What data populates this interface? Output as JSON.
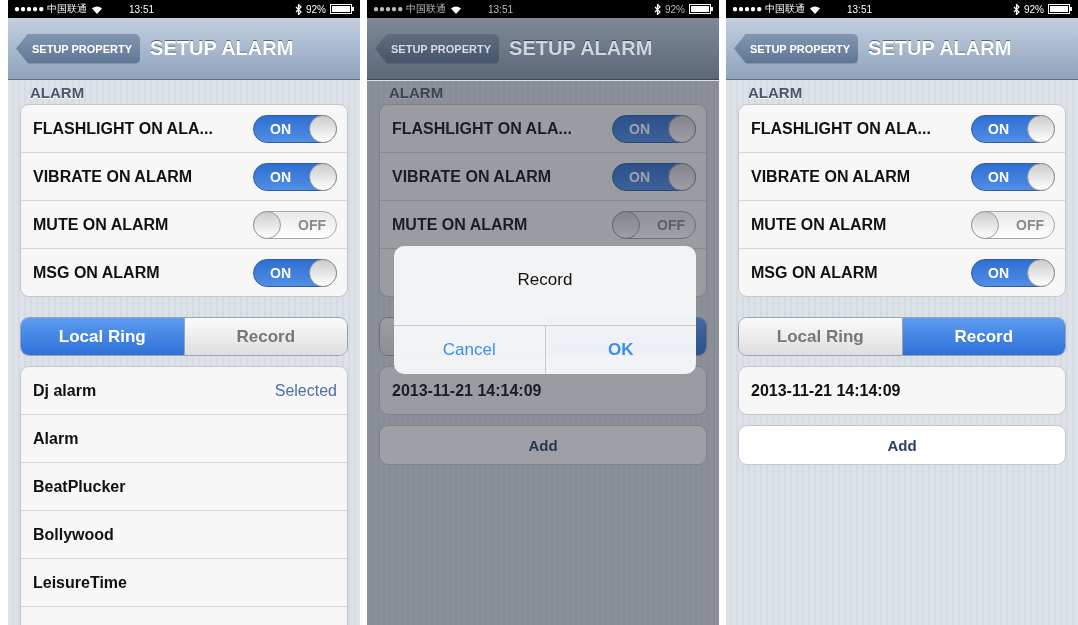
{
  "phones": [
    {
      "status_bar": {
        "carrier": "●●●●● 中国联通",
        "time": "13:51",
        "battery": "92%"
      },
      "nav": {
        "back": "SETUP PROPERTY",
        "title": "SETUP ALARM"
      },
      "section": "ALARM",
      "settings": [
        {
          "kind": "switch",
          "label": "FLASHLIGHT ON ALA...",
          "on": true,
          "state_text": "ON"
        },
        {
          "kind": "switch",
          "label": "VIBRATE ON ALARM",
          "on": true,
          "state_text": "ON"
        },
        {
          "kind": "switch",
          "label": "MUTE ON ALARM",
          "on": false,
          "state_text": "OFF"
        },
        {
          "kind": "switch",
          "label": "MSG ON ALARM",
          "on": true,
          "state_text": "ON"
        }
      ],
      "segments": [
        {
          "kind": "label",
          "label": "Local Ring",
          "selected": true
        },
        {
          "kind": "label",
          "label": "Record",
          "selected": false
        }
      ],
      "list": [
        {
          "kind": "item",
          "label": "Dj alarm",
          "detail": "Selected"
        },
        {
          "kind": "item",
          "label": "Alarm"
        },
        {
          "kind": "item",
          "label": "BeatPlucker"
        },
        {
          "kind": "item",
          "label": "Bollywood"
        },
        {
          "kind": "item",
          "label": "LeisureTime"
        },
        {
          "kind": "cut"
        }
      ]
    },
    {
      "status_bar": {
        "carrier": "●●●●● 中国联通",
        "time": "13:51",
        "battery": "92%"
      },
      "nav": {
        "back": "SETUP PROPERTY",
        "title": "SETUP ALARM"
      },
      "section": "ALARM",
      "settings": [
        {
          "kind": "switch",
          "label": "FLASHLIGHT ON ALA...",
          "on": true,
          "state_text": "ON"
        },
        {
          "kind": "switch",
          "label": "VIBRATE ON ALARM",
          "on": true,
          "state_text": "ON"
        },
        {
          "kind": "switch",
          "label": "MUTE ON ALARM",
          "on": false,
          "state_text": "OFF"
        },
        {
          "kind": "covered"
        }
      ],
      "segments": [
        {
          "kind": "covered",
          "selected": false
        },
        {
          "kind": "covered",
          "selected": true
        }
      ],
      "list": [
        {
          "kind": "item",
          "label": "2013-11-21 14:14:09"
        },
        {
          "kind": "button",
          "label": "Add"
        }
      ],
      "dialog": {
        "title": "Record",
        "buttons": [
          "Cancel",
          "OK"
        ]
      }
    },
    {
      "status_bar": {
        "carrier": "●●●●● 中国联通",
        "time": "13:51",
        "battery": "92%"
      },
      "nav": {
        "back": "SETUP PROPERTY",
        "title": "SETUP ALARM"
      },
      "section": "ALARM",
      "settings": [
        {
          "kind": "switch",
          "label": "FLASHLIGHT ON ALA...",
          "on": true,
          "state_text": "ON"
        },
        {
          "kind": "switch",
          "label": "VIBRATE ON ALARM",
          "on": true,
          "state_text": "ON"
        },
        {
          "kind": "switch",
          "label": "MUTE ON ALARM",
          "on": false,
          "state_text": "OFF"
        },
        {
          "kind": "switch",
          "label": "MSG ON ALARM",
          "on": true,
          "state_text": "ON"
        }
      ],
      "segments": [
        {
          "kind": "label",
          "label": "Local Ring",
          "selected": false
        },
        {
          "kind": "label",
          "label": "Record",
          "selected": true
        }
      ],
      "list": [
        {
          "kind": "item",
          "label": "2013-11-21 14:14:09"
        },
        {
          "kind": "button",
          "label": "Add"
        }
      ]
    }
  ]
}
